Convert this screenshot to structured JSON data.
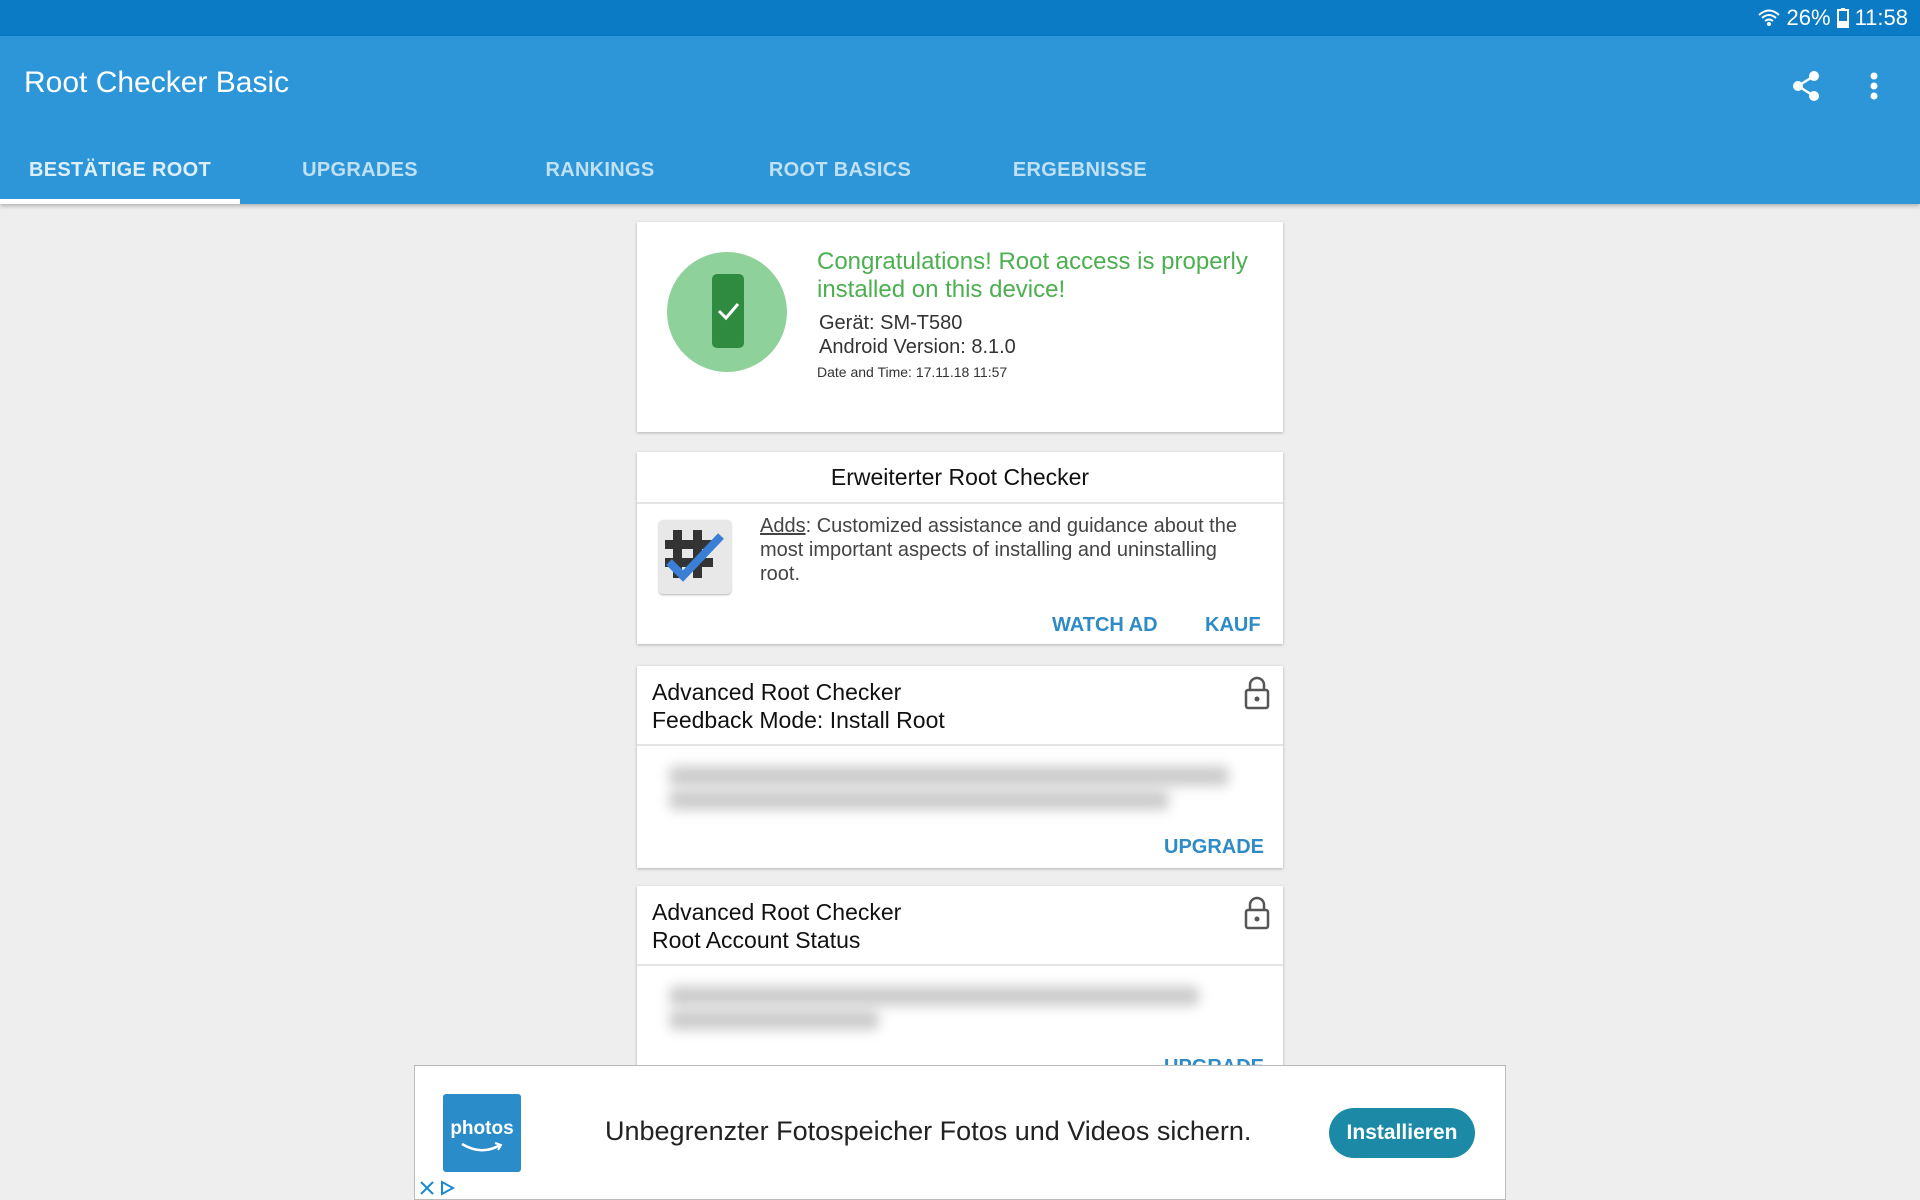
{
  "status_bar": {
    "battery_percent": "26%",
    "time": "11:58",
    "icons": [
      "wifi-icon",
      "battery-icon"
    ]
  },
  "app_bar": {
    "title": "Root Checker Basic",
    "actions": [
      "share-icon",
      "more-vert-icon"
    ],
    "color": "#2d96d8"
  },
  "tabs": [
    {
      "label": "BESTÄTIGE ROOT",
      "active": true
    },
    {
      "label": "UPGRADES",
      "active": false
    },
    {
      "label": "RANKINGS",
      "active": false
    },
    {
      "label": "ROOT BASICS",
      "active": false
    },
    {
      "label": "ERGEBNISSE",
      "active": false
    }
  ],
  "result_card": {
    "message": "Congratulations! Root access is properly installed on this device!",
    "device": "Gerät: SM-T580",
    "android_version": "Android Version: 8.1.0",
    "date_time": "Date and Time: 17.11.18 11:57",
    "message_color": "#4caf50",
    "icon": "phone-check-icon"
  },
  "extended_card": {
    "title": "Erweiterter Root Checker",
    "adds_label": "Adds",
    "description": ": Customized assistance and guidance about the most important aspects of installing and uninstalling root.",
    "watch_ad_label": "WATCH AD",
    "buy_label": "KAUF",
    "icon": "tools-check-icon"
  },
  "locked_cards": [
    {
      "title_line1": "Advanced Root Checker",
      "title_line2": "Feedback Mode: Install Root",
      "upgrade_label": "UPGRADE",
      "icon": "lock-icon"
    },
    {
      "title_line1": "Advanced Root Checker",
      "title_line2": "Root Account Status",
      "upgrade_label": "UPGRADE",
      "icon": "lock-icon"
    }
  ],
  "ad": {
    "logo_text": "photos",
    "text": "Unbegrenzter Fotospeicher Fotos und Videos sichern.",
    "install_label": "Installieren",
    "icons": [
      "close-icon",
      "ad-choices-icon"
    ]
  },
  "accent_color": "#2e8bc6"
}
